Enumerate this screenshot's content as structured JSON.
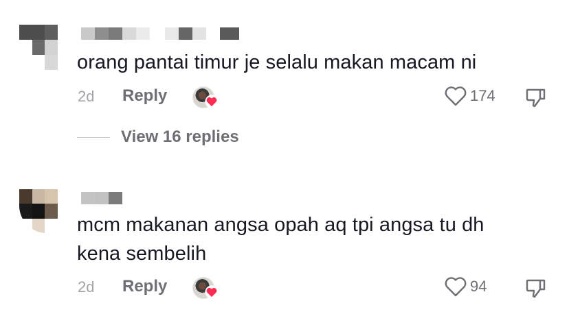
{
  "comments": [
    {
      "text": "orang pantai timur je selalu makan macam ni",
      "time": "2d",
      "reply_label": "Reply",
      "like_count": "174",
      "view_replies_label": "View 16 replies"
    },
    {
      "text": "mcm makanan angsa opah aq tpi angsa tu dh kena sembelih",
      "time": "2d",
      "reply_label": "Reply",
      "like_count": "94"
    }
  ],
  "colors": {
    "text": "#161823",
    "muted": "#a3a3a8",
    "secondary": "#6e6e73",
    "heart_red": "#fe2c55"
  }
}
